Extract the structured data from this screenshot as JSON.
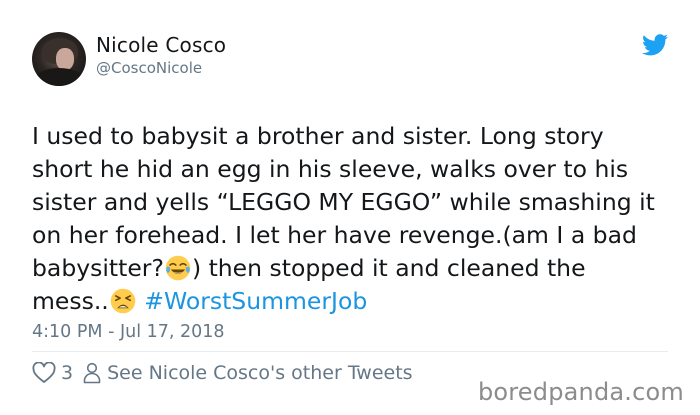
{
  "author": {
    "name": "Nicole Cosco",
    "handle": "@CoscoNicole"
  },
  "tweet": {
    "lines": [
      "I used to babysit a brother and sister. Long story",
      "short he hid an egg in his sleeve, walks over to his",
      "sister and yells “LEGGO MY EGGO” while smashing it",
      "on her forehead. I let her have revenge.(am I a bad"
    ],
    "line5_before": "babysitter?",
    "line5_after": ") then stopped it and cleaned the",
    "line6_before": "mess..",
    "hashtag": "#WorstSummerJob",
    "emojis": [
      "face-with-tears-of-joy",
      "tired-face"
    ]
  },
  "timestamp": "4:10 PM - Jul 17, 2018",
  "actions": {
    "like_count": "3",
    "other_tweets_label": "See Nicole Cosco's other Tweets"
  },
  "watermark": "boredpanda.com",
  "colors": {
    "twitter_blue": "#1da1f2",
    "hashtag": "#1b95e0",
    "secondary_text": "#657786",
    "emoji_yellow": "#ffcc4d"
  },
  "icons": [
    "twitter-bird-icon",
    "heart-icon",
    "person-icon"
  ]
}
